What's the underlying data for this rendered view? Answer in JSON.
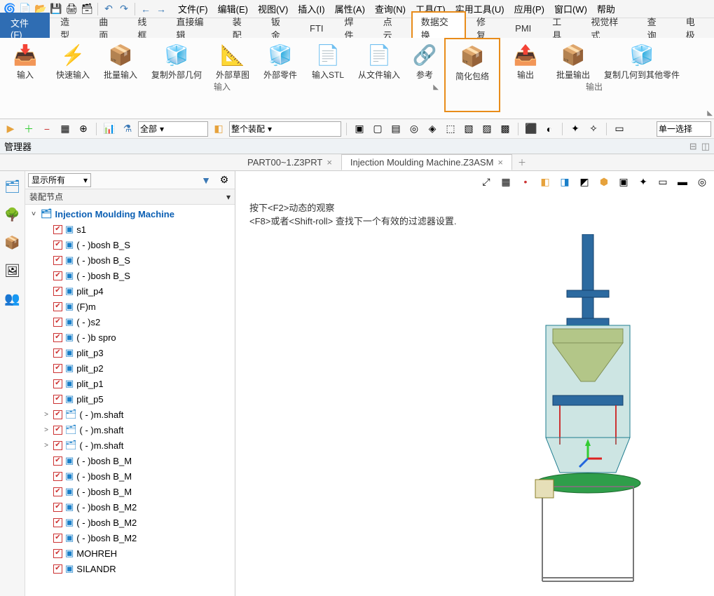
{
  "menu": {
    "file": "文件(F)",
    "edit": "编辑(E)",
    "view": "视图(V)",
    "insert": "插入(I)",
    "attr": "属性(A)",
    "query": "查询(N)",
    "tools": "工具(T)",
    "util": "实用工具(U)",
    "app": "应用(P)",
    "window": "窗口(W)",
    "help": "帮助"
  },
  "ribbontabs": {
    "file": "文件(F)",
    "model": "造型",
    "surface": "曲面",
    "wire": "线框",
    "direct": "直接编辑",
    "assemble": "装配",
    "sheet": "钣金",
    "fti": "FTI",
    "weld": "焊件",
    "point": "点云",
    "exchange": "数据交换",
    "repair": "修复",
    "pmi": "PMI",
    "tool": "工具",
    "style": "视觉样式",
    "query": "查询",
    "elec": "电极"
  },
  "ribbon": {
    "input": "输入",
    "quick": "快速输入",
    "batch": "批量输入",
    "copyext": "复制外部几何",
    "sketch": "外部草图",
    "part": "外部零件",
    "stl": "输入STL",
    "fromfile": "从文件输入",
    "ref": "参考",
    "simplify": "简化包络",
    "output": "输出",
    "batchout": "批量输出",
    "copyother": "复制几何到其他零件",
    "group_input": "输入",
    "group_output": "输出"
  },
  "quicktb": {
    "all": "全部",
    "whole": "整个装配",
    "single": "单一选择"
  },
  "manager": {
    "title": "管理器"
  },
  "tabs": {
    "t1": "PART00~1.Z3PRT",
    "t2": "Injection Moulding  Machine.Z3ASM"
  },
  "tree": {
    "filter": "显示所有",
    "header": "装配节点",
    "root": "Injection Moulding  Machine",
    "items": [
      {
        "label": "s1"
      },
      {
        "label": "( - )bosh B_S"
      },
      {
        "label": "( - )bosh B_S"
      },
      {
        "label": "( - )bosh B_S"
      },
      {
        "label": "plit_p4"
      },
      {
        "label": "(F)m"
      },
      {
        "label": "( - )s2"
      },
      {
        "label": "( - )b spro"
      },
      {
        "label": "plit_p3"
      },
      {
        "label": "plit_p2"
      },
      {
        "label": "plit_p1"
      },
      {
        "label": "plit_p5"
      },
      {
        "label": "( - )m.shaft",
        "asm": true,
        "exp": true
      },
      {
        "label": "( - )m.shaft",
        "asm": true,
        "exp": true
      },
      {
        "label": "( - )m.shaft",
        "asm": true,
        "exp": true
      },
      {
        "label": "( - )bosh B_M"
      },
      {
        "label": "( - )bosh B_M"
      },
      {
        "label": "( - )bosh B_M"
      },
      {
        "label": "( - )bosh B_M2"
      },
      {
        "label": "( - )bosh B_M2"
      },
      {
        "label": "( - )bosh B_M2"
      },
      {
        "label": "MOHREH"
      },
      {
        "label": "SILANDR"
      }
    ]
  },
  "status": {
    "line1": "按下<F2>动态的观察",
    "line2": "<F8>或者<Shift-roll> 查找下一个有效的过滤器设置."
  }
}
